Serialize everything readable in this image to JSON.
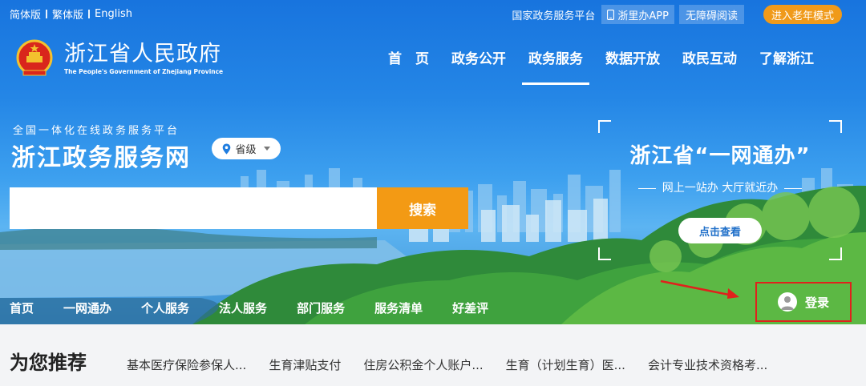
{
  "lang": {
    "simplified": "简体版",
    "traditional": "繁体版",
    "english": "English"
  },
  "util": {
    "national": "国家政务服务平台",
    "app": "浙里办APP",
    "accessible": "无障碍阅读",
    "elder": "进入老年模式"
  },
  "logo": {
    "cn": "浙江省人民政府",
    "en": "The People's Government of Zhejiang Province"
  },
  "mainnav": [
    {
      "label": "首　页"
    },
    {
      "label": "政务公开"
    },
    {
      "label": "政务服务"
    },
    {
      "label": "数据开放"
    },
    {
      "label": "政民互动"
    },
    {
      "label": "了解浙江"
    }
  ],
  "platform": {
    "tag": "全国一体化在线政务服务平台",
    "name": "浙江政务服务网",
    "region": "省级"
  },
  "search": {
    "placeholder": "",
    "button": "搜索"
  },
  "promo": {
    "title": "浙江省“一网通办”",
    "subtitle": "网上一站办 大厅就近办",
    "button": "点击查看"
  },
  "subnav": [
    {
      "label": "首页"
    },
    {
      "label": "一网通办"
    },
    {
      "label": "个人服务"
    },
    {
      "label": "法人服务"
    },
    {
      "label": "部门服务"
    },
    {
      "label": "服务清单"
    },
    {
      "label": "好差评"
    }
  ],
  "login": {
    "label": "登录"
  },
  "recommend": {
    "title": "为您推荐",
    "items": [
      "基本医疗保险参保人...",
      "生育津贴支付",
      "住房公积金个人账户...",
      "生育（计划生育）医...",
      "会计专业技术资格考..."
    ]
  },
  "colors": {
    "accent_orange": "#f39a14",
    "highlight_red": "#e0211c",
    "sky_blue": "#2486e6"
  }
}
